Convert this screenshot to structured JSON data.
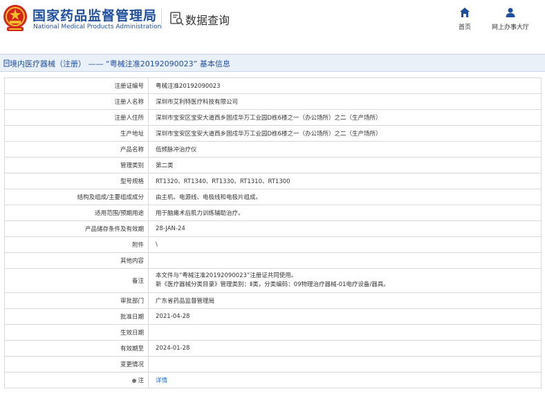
{
  "brand": {
    "name_cn": "国家药品监督管理局",
    "name_en": "National Medical Products Administration"
  },
  "header": {
    "query_title": "数据查询",
    "nav": [
      {
        "label": "首页",
        "icon": "home-icon"
      },
      {
        "label": "网上办事大厅",
        "icon": "user-icon"
      }
    ]
  },
  "page_title": "境内医疗器械（注册） —— “粤械注准20192090023” 基本信息",
  "colors": {
    "brand_blue": "#1f4e9c",
    "link_blue": "#1f6fc9",
    "title_bar_bg": "#e9f0f8",
    "emblem_red": "#d3261d",
    "emblem_gold": "#f3c02b"
  },
  "table": {
    "rows": [
      {
        "label": "注册证编号",
        "value": "粤械注准20192090023"
      },
      {
        "label": "注册人名称",
        "value": "深圳市艾利特医疗科技有限公司"
      },
      {
        "label": "注册人住所",
        "value": "深圳市宝安区宝安大道西乡固戍华万工业园D栋6楼之一（办公场所）之二（生产场所）"
      },
      {
        "label": "生产地址",
        "value": "深圳市宝安区宝安大道西乡固戍华万工业园D栋6楼之一（办公场所）之二（生产场所）"
      },
      {
        "label": "产品名称",
        "value": "低频脉冲治疗仪"
      },
      {
        "label": "管理类别",
        "value": "第二类"
      },
      {
        "label": "型号规格",
        "value": "RT1320、RT1340、RT1330、RT1310、RT1300"
      },
      {
        "label": "结构及组成/主要组成成分",
        "value": "由主机、电源线、电极线和电极片组成。"
      },
      {
        "label": "适用范围/预期用途",
        "value": "用于脑瘫术后肌力训练辅助治疗。"
      },
      {
        "label": "产品储存条件及有效期",
        "value": "28-JAN-24"
      },
      {
        "label": "附件",
        "value": "\\"
      },
      {
        "label": "其他内容",
        "value": ""
      },
      {
        "label": "备注",
        "value_lines": [
          "本文件与“粤械注准20192090023”注册证共同使用。",
          "新《医疗器械分类目录》管理类别：Ⅱ类，分类编码：09物理治疗器械-01电疗设备/器具。"
        ]
      },
      {
        "label": "审批部门",
        "value": "广东省药品监督管理局"
      },
      {
        "label": "批准日期",
        "value": "2021-04-28"
      },
      {
        "label": "生效日期",
        "value": ""
      },
      {
        "label": "有效期至",
        "value": "2024-01-28"
      },
      {
        "label": "变更情况",
        "value": ""
      },
      {
        "label": "注",
        "value": "详情"
      }
    ]
  }
}
